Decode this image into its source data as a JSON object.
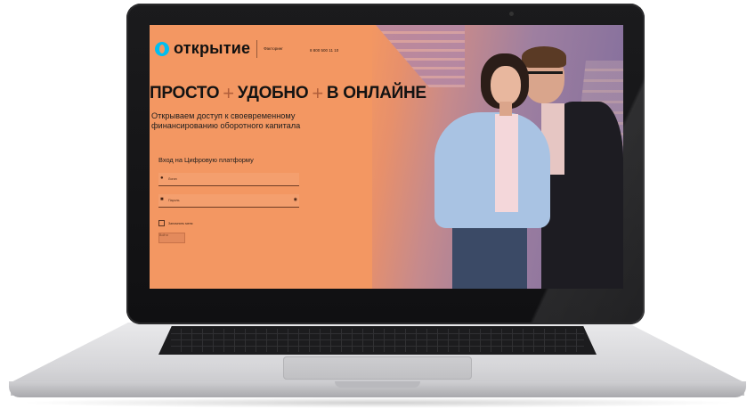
{
  "site": {
    "logo_text": "открытие",
    "tagline": "Факторинг",
    "phone": "8 800 500 11 10"
  },
  "hero": {
    "headline": [
      "ПРОСТО",
      "УДОБНО",
      "В ОНЛАЙНЕ"
    ],
    "separator": "+",
    "subhead": "Открываем доступ к своевременному финансированию оборотного капитала"
  },
  "login": {
    "title": "Вход на Цифровую платформу",
    "login_placeholder": "Логин",
    "password_placeholder": "Пароль",
    "remember_label": "Запомнить меня",
    "submit_label": "Войти"
  },
  "icons": {
    "logo": "otkritie-logo-icon",
    "user": "user-icon",
    "lock": "lock-icon",
    "eye": "eye-icon",
    "checkbox": "checkbox-icon"
  },
  "colors": {
    "accent_orange": "#f39762",
    "brand_cyan": "#00bef0"
  }
}
